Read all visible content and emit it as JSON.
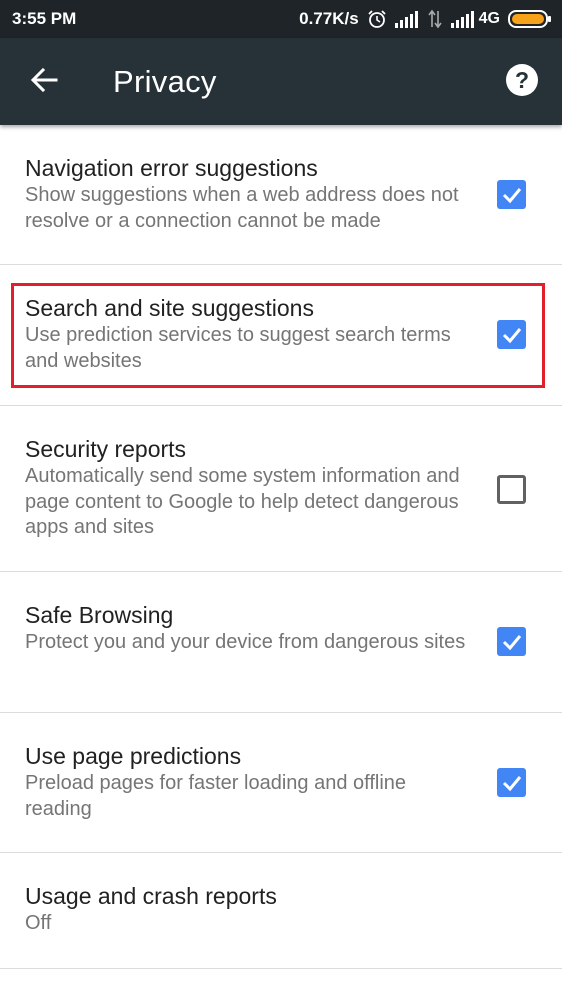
{
  "status_bar": {
    "time": "3:55 PM",
    "net_speed": "0.77K/s",
    "net_type": "4G",
    "icons": [
      "alarm-icon",
      "signal-icon",
      "no-signal-icon",
      "signal-icon",
      "battery-icon"
    ],
    "battery_color": "#f7a21b"
  },
  "toolbar": {
    "title": "Privacy",
    "back_icon": "arrow-back-icon",
    "help_icon": "help-icon",
    "background": "#263238"
  },
  "preferences": [
    {
      "title": "Navigation error suggestions",
      "summary": "Show suggestions when a web address does not resolve or a connection cannot be made",
      "checked": true
    },
    {
      "title": "Search and site suggestions",
      "summary": "Use prediction services to suggest search terms and websites",
      "checked": true,
      "highlighted": true
    },
    {
      "title": "Security reports",
      "summary": "Automatically send some system information and page content to Google to help detect dangerous apps and sites",
      "checked": false
    },
    {
      "title": "Safe Browsing",
      "summary": "Protect you and your device from dangerous sites",
      "checked": true
    },
    {
      "title": "Use page predictions",
      "summary": "Preload pages for faster loading and offline reading",
      "checked": true
    },
    {
      "title": "Usage and crash reports",
      "summary": "Off"
    }
  ],
  "colors": {
    "checkbox_checked": "#4285f4",
    "highlight": "#e0202a"
  }
}
